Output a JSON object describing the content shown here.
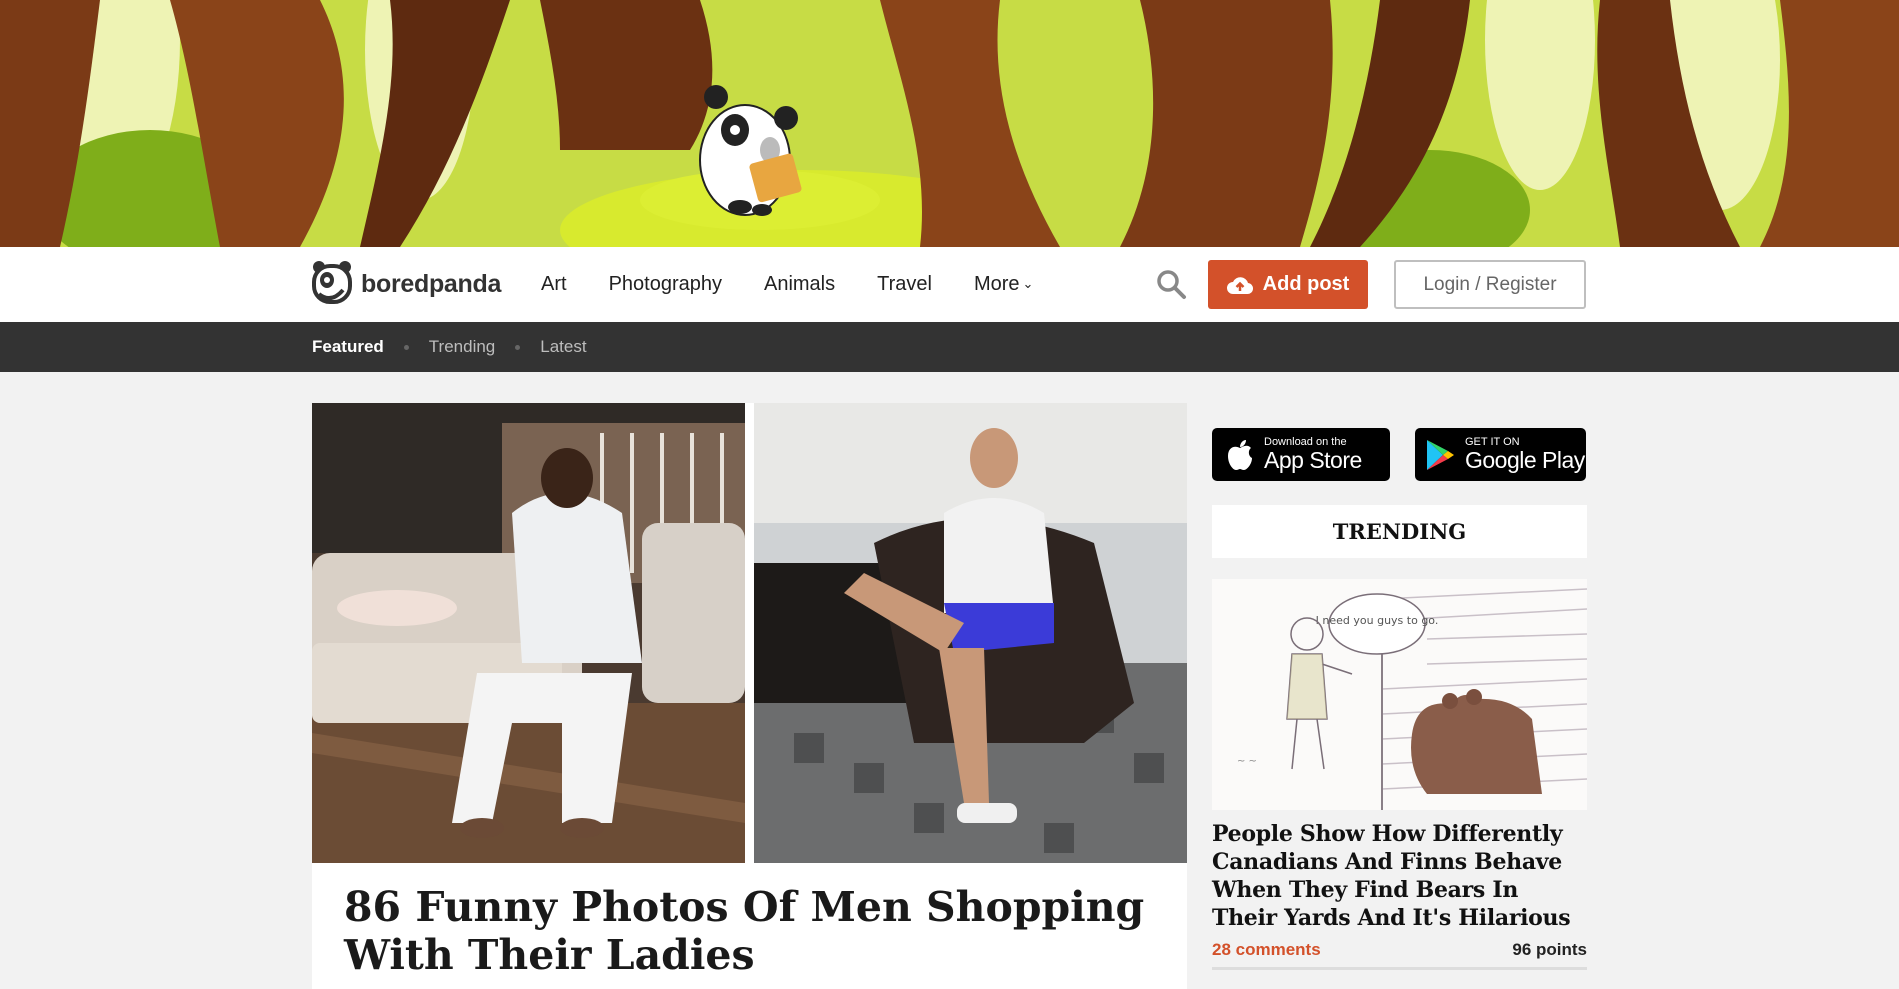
{
  "brand": {
    "name": "boredpanda"
  },
  "nav": {
    "items": [
      "Art",
      "Photography",
      "Animals",
      "Travel",
      "More"
    ],
    "add_post": "Add post",
    "login": "Login / Register"
  },
  "subnav": {
    "items": [
      "Featured",
      "Trending",
      "Latest"
    ],
    "active": "Featured"
  },
  "main_article": {
    "title": "86 Funny Photos Of Men Shopping With Their Ladies"
  },
  "sidebar": {
    "app_store": {
      "small": "Download on the",
      "big": "App Store"
    },
    "google_play": {
      "small": "GET IT ON",
      "big": "Google Play"
    },
    "trending_header": "TRENDING",
    "trending_post": {
      "comic_text": "I need you guys to go.",
      "title": "People Show How Differently Canadians And Finns Behave When They Find Bears In Their Yards And It's Hilarious",
      "comments": "28 comments",
      "points": "96 points"
    }
  },
  "colors": {
    "accent": "#d3512a",
    "subnav_bg": "#333333",
    "page_bg": "#f2f2f2"
  },
  "icons": [
    "panda-logo-icon",
    "chevron-down-icon",
    "search-icon",
    "cloud-upload-icon",
    "apple-icon",
    "google-play-icon"
  ]
}
